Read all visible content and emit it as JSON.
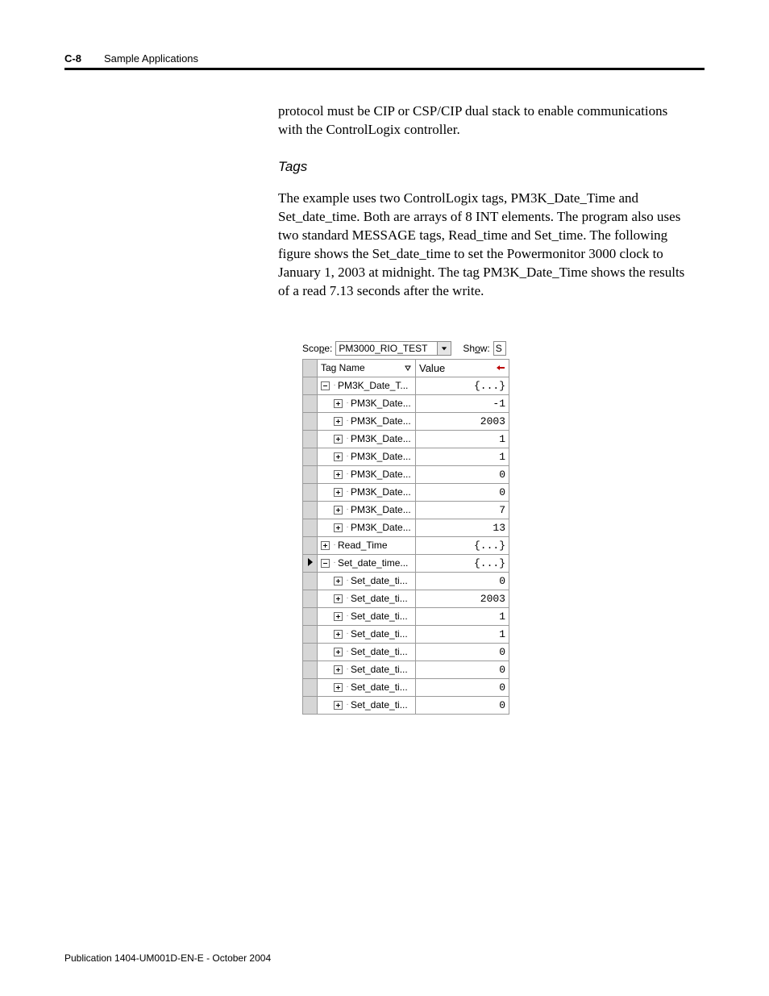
{
  "header": {
    "page_number": "C-8",
    "section_title": "Sample Applications"
  },
  "body": {
    "para1": "protocol must be CIP or CSP/CIP dual stack to enable communications with the ControlLogix controller.",
    "subhead": "Tags",
    "para2": "The example uses two ControlLogix tags, PM3K_Date_Time and Set_date_time. Both are arrays of 8 INT elements. The program also uses two standard MESSAGE tags, Read_time and Set_time. The following figure shows the Set_date_time to set the Powermonitor 3000 clock to January 1, 2003 at midnight. The tag PM3K_Date_Time shows the results of a read 7.13 seconds after the write."
  },
  "figure": {
    "scope_label": "Scope:",
    "scope_value": "PM3000_RIO_TEST",
    "show_label": "Show:",
    "show_value": "S",
    "columns": {
      "tag_name": "Tag Name",
      "value": "Value"
    },
    "rows": [
      {
        "indent": 0,
        "glyph": "minus",
        "name": "PM3K_Date_T...",
        "value": "{...}",
        "selected": false
      },
      {
        "indent": 1,
        "glyph": "plus",
        "name": "PM3K_Date...",
        "value": "-1",
        "selected": false
      },
      {
        "indent": 1,
        "glyph": "plus",
        "name": "PM3K_Date...",
        "value": "2003",
        "selected": false
      },
      {
        "indent": 1,
        "glyph": "plus",
        "name": "PM3K_Date...",
        "value": "1",
        "selected": false
      },
      {
        "indent": 1,
        "glyph": "plus",
        "name": "PM3K_Date...",
        "value": "1",
        "selected": false
      },
      {
        "indent": 1,
        "glyph": "plus",
        "name": "PM3K_Date...",
        "value": "0",
        "selected": false
      },
      {
        "indent": 1,
        "glyph": "plus",
        "name": "PM3K_Date...",
        "value": "0",
        "selected": false
      },
      {
        "indent": 1,
        "glyph": "plus",
        "name": "PM3K_Date...",
        "value": "7",
        "selected": false
      },
      {
        "indent": 1,
        "glyph": "plus",
        "name": "PM3K_Date...",
        "value": "13",
        "selected": false
      },
      {
        "indent": 0,
        "glyph": "plus",
        "name": "Read_Time",
        "value": "{...}",
        "selected": false
      },
      {
        "indent": 0,
        "glyph": "minus",
        "name": "Set_date_time...",
        "value": "{...}",
        "selected": true
      },
      {
        "indent": 1,
        "glyph": "plus",
        "name": "Set_date_ti...",
        "value": "0",
        "selected": false
      },
      {
        "indent": 1,
        "glyph": "plus",
        "name": "Set_date_ti...",
        "value": "2003",
        "selected": false
      },
      {
        "indent": 1,
        "glyph": "plus",
        "name": "Set_date_ti...",
        "value": "1",
        "selected": false
      },
      {
        "indent": 1,
        "glyph": "plus",
        "name": "Set_date_ti...",
        "value": "1",
        "selected": false
      },
      {
        "indent": 1,
        "glyph": "plus",
        "name": "Set_date_ti...",
        "value": "0",
        "selected": false
      },
      {
        "indent": 1,
        "glyph": "plus",
        "name": "Set_date_ti...",
        "value": "0",
        "selected": false
      },
      {
        "indent": 1,
        "glyph": "plus",
        "name": "Set_date_ti...",
        "value": "0",
        "selected": false
      },
      {
        "indent": 1,
        "glyph": "plus",
        "name": "Set_date_ti...",
        "value": "0",
        "selected": false
      }
    ]
  },
  "footer": "Publication 1404-UM001D-EN-E - October 2004"
}
